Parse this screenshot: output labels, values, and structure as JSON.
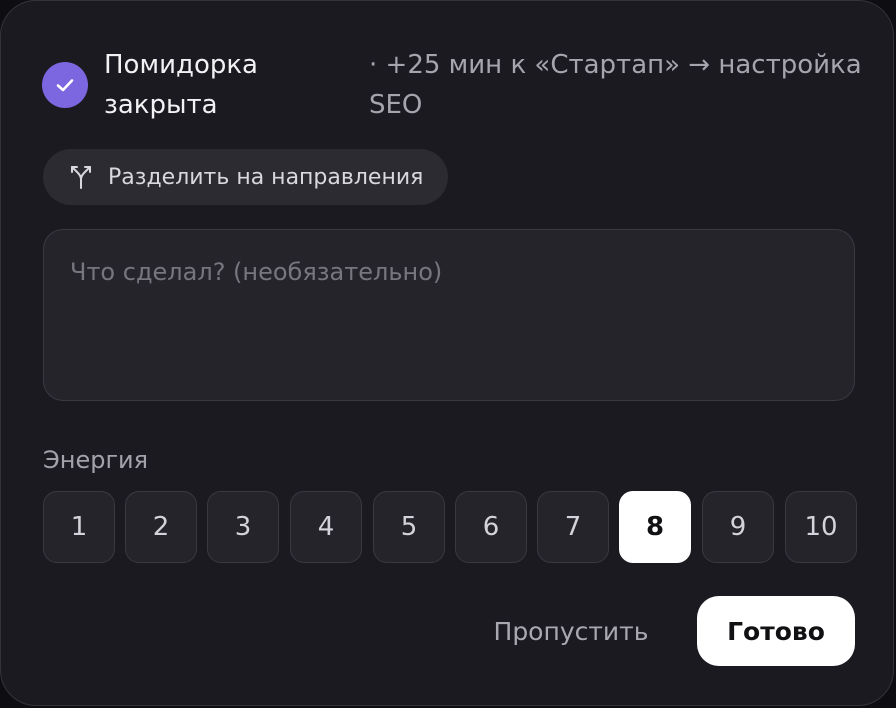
{
  "header": {
    "title": "Помидорка закрыта",
    "summary": "· +25 мин к «Стартап» → настройка SEO"
  },
  "split_button": {
    "label": "Разделить на направления",
    "icon": "split-arrows-icon"
  },
  "note": {
    "placeholder": "Что сделал? (необязательно)",
    "value": ""
  },
  "energy": {
    "label": "Энергия",
    "options": [
      "1",
      "2",
      "3",
      "4",
      "5",
      "6",
      "7",
      "8",
      "9",
      "10"
    ],
    "selected": "8"
  },
  "actions": {
    "skip_label": "Пропустить",
    "done_label": "Готово"
  },
  "colors": {
    "accent": "#7c67e0",
    "card_background": "#1b1a20",
    "selected_background": "#ffffff"
  }
}
